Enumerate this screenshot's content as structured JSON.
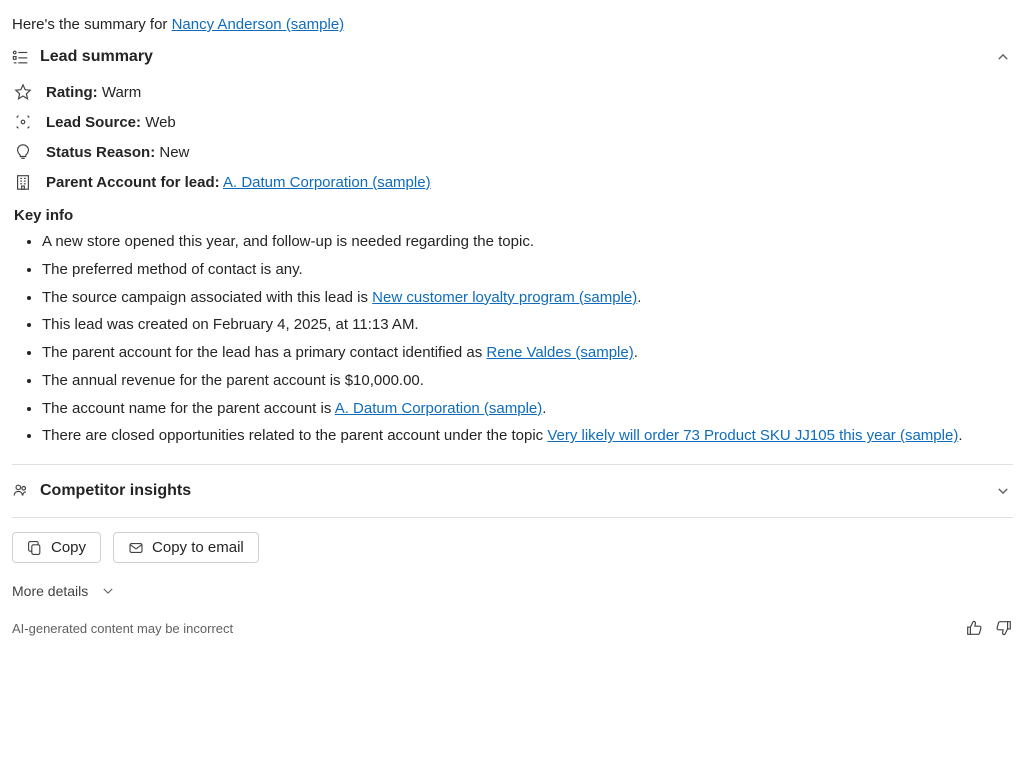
{
  "intro": {
    "prefix": "Here's the summary for ",
    "link": "Nancy Anderson (sample)"
  },
  "lead_summary": {
    "title": "Lead summary",
    "fields": {
      "rating": {
        "label": "Rating:",
        "value": "Warm"
      },
      "source": {
        "label": "Lead Source:",
        "value": "Web"
      },
      "status": {
        "label": "Status Reason:",
        "value": "New"
      },
      "parent": {
        "label": "Parent Account for lead:",
        "link": "A. Datum Corporation (sample)"
      }
    },
    "keyinfo_title": "Key info",
    "keyinfo": {
      "item0": "A new store opened this year, and follow-up is needed regarding the topic.",
      "item1": "The preferred method of contact is any.",
      "item2_pre": "The source campaign associated with this lead is ",
      "item2_link": "New customer loyalty program (sample)",
      "item2_post": ".",
      "item3": "This lead was created on February 4, 2025, at 11:13 AM.",
      "item4_pre": "The parent account for the lead has a primary contact identified as ",
      "item4_link": "Rene Valdes (sample)",
      "item4_post": ".",
      "item5": "The annual revenue for the parent account is $10,000.00.",
      "item6_pre": "The account name for the parent account is ",
      "item6_link": "A. Datum Corporation (sample)",
      "item6_post": ".",
      "item7_pre": "There are closed opportunities related to the parent account under the topic ",
      "item7_link": "Very likely will order 73 Product SKU JJ105 this year (sample)",
      "item7_post": "."
    }
  },
  "competitor": {
    "title": "Competitor insights"
  },
  "actions": {
    "copy": "Copy",
    "copy_email": "Copy to email"
  },
  "more_details_label": "More details",
  "footer_note": "AI-generated content may be incorrect"
}
